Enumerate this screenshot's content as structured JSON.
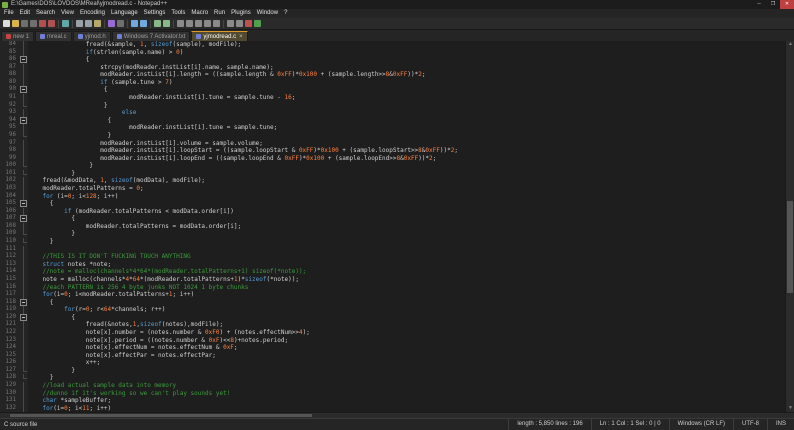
{
  "window": {
    "title": "E:\\Games\\DOS\\LOVDOS\\MReal\\yjmodread.c - Notepad++",
    "controls": {
      "minimize": "─",
      "maximize": "❐",
      "close": "✕"
    }
  },
  "menu": {
    "items": [
      "File",
      "Edit",
      "Search",
      "View",
      "Encoding",
      "Language",
      "Settings",
      "Tools",
      "Macro",
      "Run",
      "Plugins",
      "Window",
      "?"
    ]
  },
  "toolbar": {
    "icons": [
      {
        "name": "new-file-icon",
        "color": "#dcdcdc"
      },
      {
        "name": "open-folder-icon",
        "color": "#d8b44a"
      },
      {
        "name": "save-icon",
        "color": "#6f6f6f"
      },
      {
        "name": "save-all-icon",
        "color": "#6f6f6f"
      },
      {
        "name": "close-icon",
        "color": "#b05050"
      },
      {
        "name": "close-all-icon",
        "color": "#b05050"
      },
      {
        "sep": true
      },
      {
        "name": "print-icon",
        "color": "#5fa8a8"
      },
      {
        "sep": true
      },
      {
        "name": "cut-icon",
        "color": "#9aa0a8"
      },
      {
        "name": "copy-icon",
        "color": "#9aa0a8"
      },
      {
        "name": "paste-icon",
        "color": "#b8a868"
      },
      {
        "sep": true
      },
      {
        "name": "undo-icon",
        "color": "#9a6ad8"
      },
      {
        "name": "redo-icon",
        "color": "#6f6f6f"
      },
      {
        "sep": true
      },
      {
        "name": "find-icon",
        "color": "#70a8e0"
      },
      {
        "name": "replace-icon",
        "color": "#70a8e0"
      },
      {
        "sep": true
      },
      {
        "name": "zoom-in-icon",
        "color": "#88b888"
      },
      {
        "name": "zoom-out-icon",
        "color": "#88b888"
      },
      {
        "sep": true
      },
      {
        "name": "sync-vertical-icon",
        "color": "#8a8a8a"
      },
      {
        "name": "sync-horizontal-icon",
        "color": "#8a8a8a"
      },
      {
        "name": "word-wrap-icon",
        "color": "#8a8a8a"
      },
      {
        "name": "show-all-characters-icon",
        "color": "#8a8a8a"
      },
      {
        "name": "indent-guide-icon",
        "color": "#8a8a8a"
      },
      {
        "sep": true
      },
      {
        "name": "function-list-icon",
        "color": "#8a8a8a"
      },
      {
        "name": "document-map-icon",
        "color": "#8a8a8a"
      },
      {
        "name": "record-macro-icon",
        "color": "#c05050"
      },
      {
        "name": "play-macro-icon",
        "color": "#50a050"
      }
    ]
  },
  "tabs": {
    "state_colors": {
      "saved": "#6f7fd8",
      "unsaved": "#c74440"
    },
    "items": [
      {
        "label": "new 1",
        "state": "unsaved",
        "active": false
      },
      {
        "label": "mreal.c",
        "state": "saved",
        "active": false
      },
      {
        "label": "yjmod.h",
        "state": "saved",
        "active": false
      },
      {
        "label": "Windows 7 Activator.txt",
        "state": "saved",
        "active": false
      },
      {
        "label": "yjmodread.c",
        "state": "saved",
        "active": true
      }
    ],
    "close_glyph": "×"
  },
  "editor": {
    "first_line": 84,
    "colors": {
      "d": "#d0d0d0",
      "k": "#569cd6",
      "n": "#ff8040",
      "c": "#3c9b3c"
    },
    "lines": [
      {
        "n": 84,
        "i": 16,
        "f": "l",
        "s": [
          [
            "d",
            "fread(&sample, "
          ],
          [
            "n",
            "1"
          ],
          [
            "d",
            ", "
          ],
          [
            "k",
            "sizeof"
          ],
          [
            "d",
            "(sample), modFile);"
          ]
        ]
      },
      {
        "n": 85,
        "i": 16,
        "f": "l",
        "s": [
          [
            "k",
            "if"
          ],
          [
            "d",
            "(strlen(sample.name) > "
          ],
          [
            "n",
            "0"
          ],
          [
            "d",
            ")"
          ]
        ]
      },
      {
        "n": 86,
        "i": 16,
        "f": "o",
        "s": [
          [
            "d",
            "{"
          ]
        ]
      },
      {
        "n": 87,
        "i": 20,
        "f": "l",
        "s": [
          [
            "d",
            "strcpy(modReader.instList[i].name, sample.name);"
          ]
        ]
      },
      {
        "n": 88,
        "i": 20,
        "f": "l",
        "s": [
          [
            "d",
            "modReader.instList[i].length = ((sample.length & "
          ],
          [
            "n",
            "0xFF"
          ],
          [
            "d",
            ")*"
          ],
          [
            "n",
            "0x100"
          ],
          [
            "d",
            " + (sample.length>>"
          ],
          [
            "n",
            "8"
          ],
          [
            "d",
            "&"
          ],
          [
            "n",
            "0xFF"
          ],
          [
            "d",
            "))*"
          ],
          [
            "n",
            "2"
          ],
          [
            "d",
            ";"
          ]
        ]
      },
      {
        "n": 89,
        "i": 20,
        "f": "l",
        "s": [
          [
            "k",
            "if"
          ],
          [
            "d",
            " (sample.tune > "
          ],
          [
            "n",
            "7"
          ],
          [
            "d",
            ")"
          ]
        ]
      },
      {
        "n": 90,
        "i": 21,
        "f": "o",
        "s": [
          [
            "d",
            "{"
          ]
        ]
      },
      {
        "n": 91,
        "i": 28,
        "f": "l",
        "s": [
          [
            "d",
            "modReader.instList[i].tune = sample.tune - "
          ],
          [
            "n",
            "16"
          ],
          [
            "d",
            ";"
          ]
        ]
      },
      {
        "n": 92,
        "i": 21,
        "f": "e",
        "s": [
          [
            "d",
            "}"
          ]
        ]
      },
      {
        "n": 93,
        "i": 26,
        "f": "l",
        "s": [
          [
            "k",
            "else"
          ]
        ]
      },
      {
        "n": 94,
        "i": 22,
        "f": "o",
        "s": [
          [
            "d",
            "{"
          ]
        ]
      },
      {
        "n": 95,
        "i": 28,
        "f": "l",
        "s": [
          [
            "d",
            "modReader.instList[i].tune = sample.tune;"
          ]
        ]
      },
      {
        "n": 96,
        "i": 22,
        "f": "e",
        "s": [
          [
            "d",
            "}"
          ]
        ]
      },
      {
        "n": 97,
        "i": 20,
        "f": "l",
        "s": [
          [
            "d",
            "modReader.instList[i].volume = sample.volume;"
          ]
        ]
      },
      {
        "n": 98,
        "i": 20,
        "f": "l",
        "s": [
          [
            "d",
            "modReader.instList[i].loopStart = ((sample.loopStart & "
          ],
          [
            "n",
            "0xFF"
          ],
          [
            "d",
            ")*"
          ],
          [
            "n",
            "0x100"
          ],
          [
            "d",
            " + (sample.loopStart>>"
          ],
          [
            "n",
            "8"
          ],
          [
            "d",
            "&"
          ],
          [
            "n",
            "0xFF"
          ],
          [
            "d",
            "))*"
          ],
          [
            "n",
            "2"
          ],
          [
            "d",
            ";"
          ]
        ]
      },
      {
        "n": 99,
        "i": 20,
        "f": "l",
        "s": [
          [
            "d",
            "modReader.instList[i].loopEnd = ((sample.loopEnd & "
          ],
          [
            "n",
            "0xFF"
          ],
          [
            "d",
            ")*"
          ],
          [
            "n",
            "0x100"
          ],
          [
            "d",
            " + (sample.loopEnd>>"
          ],
          [
            "n",
            "8"
          ],
          [
            "d",
            "&"
          ],
          [
            "n",
            "0xFF"
          ],
          [
            "d",
            "))*"
          ],
          [
            "n",
            "2"
          ],
          [
            "d",
            ";"
          ]
        ]
      },
      {
        "n": 100,
        "i": 17,
        "f": "e",
        "s": [
          [
            "d",
            "}"
          ]
        ]
      },
      {
        "n": 101,
        "i": 12,
        "f": "e",
        "s": [
          [
            "d",
            "}"
          ]
        ]
      },
      {
        "n": 102,
        "i": 4,
        "f": "l",
        "s": [
          [
            "d",
            "fread(&modData, "
          ],
          [
            "n",
            "1"
          ],
          [
            "d",
            ", "
          ],
          [
            "k",
            "sizeof"
          ],
          [
            "d",
            "(modData), modFile);"
          ]
        ]
      },
      {
        "n": 103,
        "i": 4,
        "f": "l",
        "s": [
          [
            "d",
            "modReader.totalPatterns = "
          ],
          [
            "n",
            "0"
          ],
          [
            "d",
            ";"
          ]
        ]
      },
      {
        "n": 104,
        "i": 4,
        "f": "l",
        "s": [
          [
            "k",
            "for"
          ],
          [
            "d",
            " (i="
          ],
          [
            "n",
            "0"
          ],
          [
            "d",
            "; i<"
          ],
          [
            "n",
            "128"
          ],
          [
            "d",
            "; i++)"
          ]
        ]
      },
      {
        "n": 105,
        "i": 6,
        "f": "o",
        "s": [
          [
            "d",
            "{"
          ]
        ]
      },
      {
        "n": 106,
        "i": 10,
        "f": "l",
        "s": [
          [
            "k",
            "if"
          ],
          [
            "d",
            " (modReader.totalPatterns < modData.order[i])"
          ]
        ]
      },
      {
        "n": 107,
        "i": 12,
        "f": "o",
        "s": [
          [
            "d",
            "{"
          ]
        ]
      },
      {
        "n": 108,
        "i": 16,
        "f": "l",
        "s": [
          [
            "d",
            "modReader.totalPatterns = modData.order[i];"
          ]
        ]
      },
      {
        "n": 109,
        "i": 12,
        "f": "e",
        "s": [
          [
            "d",
            "}"
          ]
        ]
      },
      {
        "n": 110,
        "i": 6,
        "f": "e",
        "s": [
          [
            "d",
            "}"
          ]
        ]
      },
      {
        "n": 111,
        "i": 0,
        "f": "l",
        "s": []
      },
      {
        "n": 112,
        "i": 4,
        "f": "l",
        "s": [
          [
            "c",
            "//THIS IS IT DON'T FUCKING TOUCH ANYTHING"
          ]
        ]
      },
      {
        "n": 113,
        "i": 4,
        "f": "l",
        "s": [
          [
            "k",
            "struct"
          ],
          [
            "d",
            " notes *note;"
          ]
        ]
      },
      {
        "n": 114,
        "i": 4,
        "f": "l",
        "s": [
          [
            "c",
            "//note = malloc(channels*4*64*(modReader.totalPatterns+1) sizeof(*note));"
          ]
        ]
      },
      {
        "n": 115,
        "i": 4,
        "f": "l",
        "s": [
          [
            "d",
            "note = malloc(channels*"
          ],
          [
            "n",
            "4"
          ],
          [
            "d",
            "*"
          ],
          [
            "n",
            "64"
          ],
          [
            "d",
            "*(modReader.totalPatterns+"
          ],
          [
            "n",
            "1"
          ],
          [
            "d",
            ")*"
          ],
          [
            "k",
            "sizeof"
          ],
          [
            "d",
            "(*note));"
          ]
        ]
      },
      {
        "n": 116,
        "i": 4,
        "f": "l",
        "s": [
          [
            "c",
            "//each PATTERN is 256 4 byte junks NOT 1024 1 byte chunks"
          ]
        ]
      },
      {
        "n": 117,
        "i": 4,
        "f": "l",
        "s": [
          [
            "k",
            "for"
          ],
          [
            "d",
            "(i="
          ],
          [
            "n",
            "0"
          ],
          [
            "d",
            "; i<modReader.totalPatterns+"
          ],
          [
            "n",
            "1"
          ],
          [
            "d",
            "; i++)"
          ]
        ]
      },
      {
        "n": 118,
        "i": 6,
        "f": "o",
        "s": [
          [
            "d",
            "{"
          ]
        ]
      },
      {
        "n": 119,
        "i": 10,
        "f": "l",
        "s": [
          [
            "k",
            "for"
          ],
          [
            "d",
            "(r="
          ],
          [
            "n",
            "0"
          ],
          [
            "d",
            "; r<"
          ],
          [
            "n",
            "64"
          ],
          [
            "d",
            "*channels; r++)"
          ]
        ]
      },
      {
        "n": 120,
        "i": 12,
        "f": "o",
        "s": [
          [
            "d",
            "{"
          ]
        ]
      },
      {
        "n": 121,
        "i": 16,
        "f": "l",
        "s": [
          [
            "d",
            "fread(&notes,"
          ],
          [
            "n",
            "1"
          ],
          [
            "d",
            ","
          ],
          [
            "k",
            "sizeof"
          ],
          [
            "d",
            "(notes),modFile);"
          ]
        ]
      },
      {
        "n": 122,
        "i": 16,
        "f": "l",
        "s": [
          [
            "d",
            "note[x].number = (notes.number & "
          ],
          [
            "n",
            "0xF0"
          ],
          [
            "d",
            ") + (notes.effectNum>>"
          ],
          [
            "n",
            "4"
          ],
          [
            "d",
            ");"
          ]
        ]
      },
      {
        "n": 123,
        "i": 16,
        "f": "l",
        "s": [
          [
            "d",
            "note[x].period = ((notes.number & "
          ],
          [
            "n",
            "0xF"
          ],
          [
            "d",
            ")<<"
          ],
          [
            "n",
            "8"
          ],
          [
            "d",
            ")+notes.period;"
          ]
        ]
      },
      {
        "n": 124,
        "i": 16,
        "f": "l",
        "s": [
          [
            "d",
            "note[x].effectNum = notes.effectNum & "
          ],
          [
            "n",
            "0xF"
          ],
          [
            "d",
            ";"
          ]
        ]
      },
      {
        "n": 125,
        "i": 16,
        "f": "l",
        "s": [
          [
            "d",
            "note[x].effectPar = notes.effectPar;"
          ]
        ]
      },
      {
        "n": 126,
        "i": 16,
        "f": "l",
        "s": [
          [
            "d",
            "x++;"
          ]
        ]
      },
      {
        "n": 127,
        "i": 12,
        "f": "e",
        "s": [
          [
            "d",
            "}"
          ]
        ]
      },
      {
        "n": 128,
        "i": 6,
        "f": "e",
        "s": [
          [
            "d",
            "}"
          ]
        ]
      },
      {
        "n": 129,
        "i": 4,
        "f": "l",
        "s": [
          [
            "c",
            "//load actual sample data into memory"
          ]
        ]
      },
      {
        "n": 130,
        "i": 4,
        "f": "l",
        "s": [
          [
            "c",
            "//dunno if it's working so we can't play sounds yet!"
          ]
        ]
      },
      {
        "n": 131,
        "i": 4,
        "f": "l",
        "s": [
          [
            "k",
            "char"
          ],
          [
            "d",
            " *sampleBuffer;"
          ]
        ]
      },
      {
        "n": 132,
        "i": 4,
        "f": "l",
        "s": [
          [
            "k",
            "for"
          ],
          [
            "d",
            "(i="
          ],
          [
            "n",
            "0"
          ],
          [
            "d",
            "; i<"
          ],
          [
            "n",
            "11"
          ],
          [
            "d",
            "; i++)"
          ]
        ]
      }
    ]
  },
  "statusbar": {
    "doc_type": "C source file",
    "length_lines": "length : 5,850    lines : 196",
    "position": "Ln : 1    Col : 1    Sel : 0 | 0",
    "eol": "Windows (CR LF)",
    "encoding": "UTF-8",
    "mode": "INS"
  }
}
